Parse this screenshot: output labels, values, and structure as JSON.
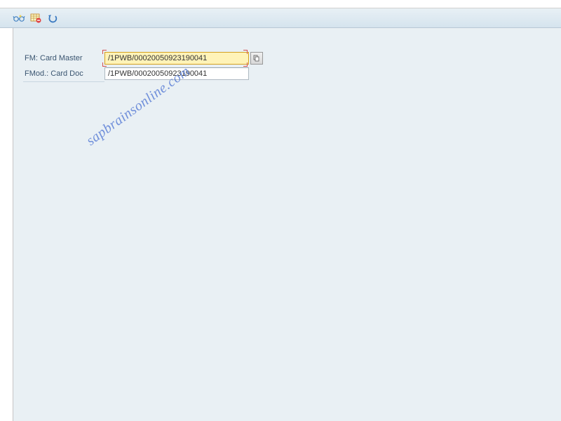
{
  "toolbar": {
    "icons": {
      "glasses": "glasses-icon",
      "table": "table-red-icon",
      "undo": "undo-icon"
    }
  },
  "form": {
    "row1": {
      "label": "FM: Card Master",
      "value": "/1PWB/00020050923190041"
    },
    "row2": {
      "label": "FMod.: Card Doc",
      "value": "/1PWB/00020050923190041"
    }
  },
  "watermark": "sapbrainsonline.com"
}
